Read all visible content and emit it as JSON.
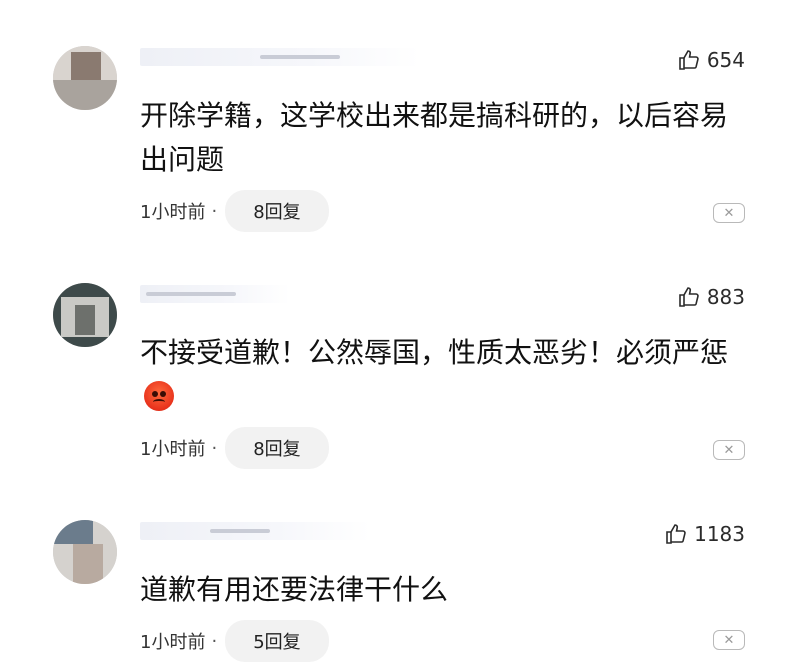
{
  "comments": [
    {
      "likes": "654",
      "text": "开除学籍，这学校出来都是搞科研的，以后容易出问题",
      "time": "1小时前",
      "replies": "8回复"
    },
    {
      "likes": "883",
      "text": "不接受道歉！公然辱国，性质太恶劣！必须严惩",
      "emoji": "angry-face",
      "time": "1小时前",
      "replies": "8回复"
    },
    {
      "likes": "1183",
      "text": "道歉有用还要法律干什么",
      "time": "1小时前",
      "replies": "5回复"
    }
  ],
  "icons": {
    "like": "thumbs-up-icon",
    "close": "close-icon",
    "avatar": "blurred-avatar"
  },
  "colors": {
    "reply_pill_bg": "#f2f2f2",
    "text": "#111111",
    "meta": "#333333"
  }
}
